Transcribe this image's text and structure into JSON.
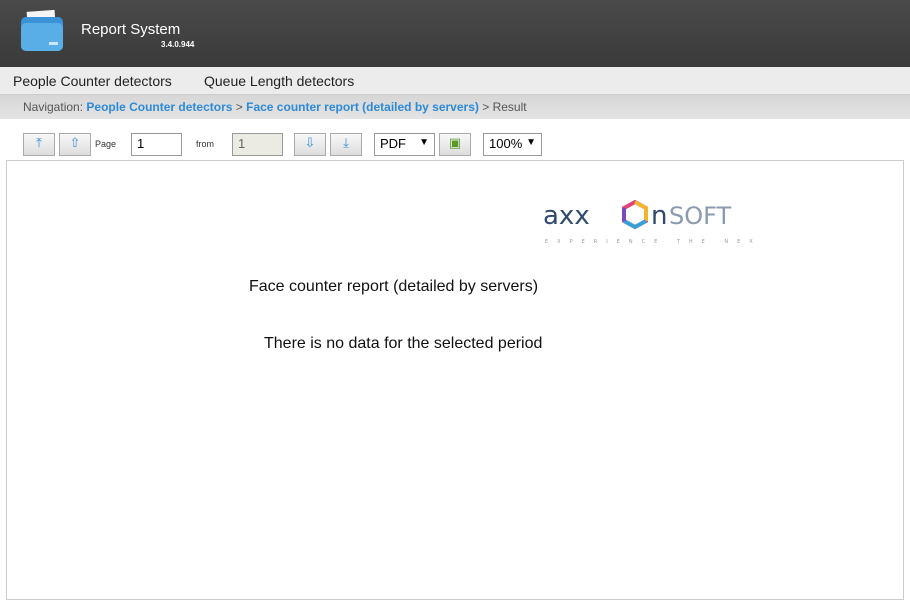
{
  "app": {
    "title": "Report System",
    "version": "3.4.0.944"
  },
  "menu": [
    {
      "label": "People Counter detectors"
    },
    {
      "label": "Queue Length detectors"
    }
  ],
  "nav": {
    "prefix": "Navigation:",
    "crumbs": [
      "People Counter detectors",
      "Face counter report (detailed by servers)"
    ],
    "sep": ">",
    "current": "Result"
  },
  "toolbar": {
    "page_label": "Page",
    "page_value": "1",
    "from_label": "from",
    "total_pages": "1",
    "format": "PDF",
    "zoom": "100%"
  },
  "brand": {
    "name_left": "axx",
    "name_right": "nSOFT",
    "tagline": "EXPERIENCE THE NEXT"
  },
  "report": {
    "title": "Face counter report (detailed by servers)",
    "message": "There is no data for the selected period"
  }
}
